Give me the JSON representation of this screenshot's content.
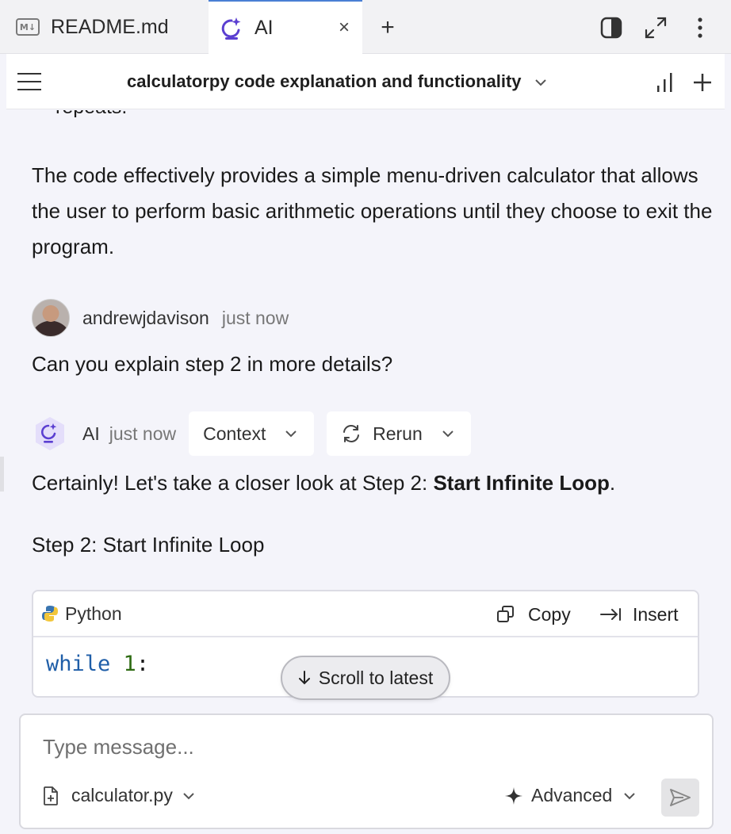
{
  "tabs": [
    {
      "label": "README.md",
      "badge": "M↓"
    },
    {
      "label": "AI"
    }
  ],
  "header": {
    "title": "calculatorpy code explanation and functionality"
  },
  "chat": {
    "partial_line": "repeats.",
    "summary": "The code effectively provides a simple menu-driven calculator that allows the user to perform basic arithmetic operations until they choose to exit the program.",
    "user": {
      "name": "andrewjdavison",
      "time": "just now",
      "message": "Can you explain step 2 in more details?"
    },
    "ai": {
      "name": "AI",
      "time": "just now",
      "context_label": "Context",
      "rerun_label": "Rerun",
      "answer_prefix": "Certainly! Let's take a closer look at Step 2: ",
      "answer_bold": "Start Infinite Loop",
      "answer_suffix": ".",
      "step_heading": "Step 2: Start Infinite Loop"
    },
    "code": {
      "language": "Python",
      "copy_label": "Copy",
      "insert_label": "Insert",
      "keyword": "while",
      "number": "1",
      "colon": ":"
    },
    "scroll_label": "Scroll to latest"
  },
  "composer": {
    "placeholder": "Type message...",
    "file": "calculator.py",
    "advanced_label": "Advanced"
  },
  "colors": {
    "accent": "#4a7fd4",
    "ai_logo": "#5b3fd1",
    "keyword": "#1f5ea8",
    "number": "#2e6b12"
  }
}
